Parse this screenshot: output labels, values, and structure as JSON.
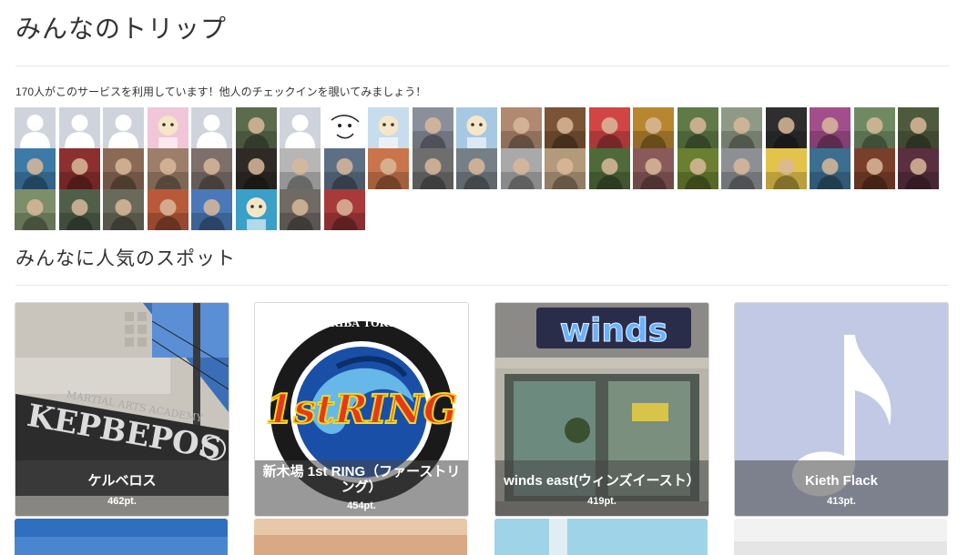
{
  "page": {
    "title": "みんなのトリップ",
    "intro": "170人がこのサービスを利用しています！他人のチェックインを覗いてみましょう！",
    "popular_heading": "みんなに人気のスポット"
  },
  "avatars": [
    {
      "kind": "default"
    },
    {
      "kind": "default"
    },
    {
      "kind": "default"
    },
    {
      "kind": "cartoon",
      "color": "#f0c6d8"
    },
    {
      "kind": "default"
    },
    {
      "kind": "photo",
      "color": "#5b6b4d"
    },
    {
      "kind": "default"
    },
    {
      "kind": "smiley"
    },
    {
      "kind": "cartoon",
      "color": "#c7dcec"
    },
    {
      "kind": "photo",
      "color": "#8a8f9c"
    },
    {
      "kind": "cartoon",
      "color": "#a7c8e2"
    },
    {
      "kind": "photo",
      "color": "#b08970"
    },
    {
      "kind": "photo",
      "color": "#7a5434"
    },
    {
      "kind": "photo",
      "color": "#d14545"
    },
    {
      "kind": "photo",
      "color": "#b8862f"
    },
    {
      "kind": "photo",
      "color": "#5f7a46"
    },
    {
      "kind": "photo",
      "color": "#8f9a86"
    },
    {
      "kind": "photo",
      "color": "#2e2e2e"
    },
    {
      "kind": "photo",
      "color": "#a14f8c"
    },
    {
      "kind": "photo",
      "color": "#6f8a63"
    },
    {
      "kind": "photo",
      "color": "#4f5a3d"
    },
    {
      "kind": "photo",
      "color": "#3d7aa8"
    },
    {
      "kind": "photo",
      "color": "#8c2f2f"
    },
    {
      "kind": "photo",
      "color": "#8a6a55"
    },
    {
      "kind": "photo",
      "color": "#9c7e6a"
    },
    {
      "kind": "photo",
      "color": "#7d6f6a"
    },
    {
      "kind": "photo",
      "color": "#2f2a26"
    },
    {
      "kind": "photo",
      "color": "#b6b6b6"
    },
    {
      "kind": "photo",
      "color": "#5d6f84"
    },
    {
      "kind": "photo",
      "color": "#c9744a"
    },
    {
      "kind": "photo",
      "color": "#6e6e6e"
    },
    {
      "kind": "photo",
      "color": "#777f86"
    },
    {
      "kind": "photo",
      "color": "#a9a9a9"
    },
    {
      "kind": "photo",
      "color": "#b39a7a"
    },
    {
      "kind": "photo",
      "color": "#4f6a3a"
    },
    {
      "kind": "photo",
      "color": "#8a5a5a"
    },
    {
      "kind": "photo",
      "color": "#6a7f2f"
    },
    {
      "kind": "photo",
      "color": "#8c9094"
    },
    {
      "kind": "photo",
      "color": "#e3c34a"
    },
    {
      "kind": "photo",
      "color": "#3b6e8f"
    },
    {
      "kind": "photo",
      "color": "#7a3f2a"
    },
    {
      "kind": "photo",
      "color": "#5a2f3f"
    },
    {
      "kind": "photo",
      "color": "#7d8f6a"
    },
    {
      "kind": "photo",
      "color": "#4f5f4a"
    },
    {
      "kind": "photo",
      "color": "#6a6a5a"
    },
    {
      "kind": "photo",
      "color": "#b85a3a"
    },
    {
      "kind": "photo",
      "color": "#4a78b8"
    },
    {
      "kind": "cartoon",
      "color": "#3aa0c8"
    },
    {
      "kind": "photo",
      "color": "#6f6a63"
    },
    {
      "kind": "photo",
      "color": "#a83a3a"
    }
  ],
  "spots": [
    {
      "name": "ケルベロス",
      "points": "462pt.",
      "photo": "kerberos"
    },
    {
      "name": "新木場 1st RING（ファーストリング）",
      "points": "454pt.",
      "photo": "ring"
    },
    {
      "name": "winds east(ウィンズイースト）",
      "points": "419pt.",
      "photo": "winds"
    },
    {
      "name": "Kieth Flack",
      "points": "413pt.",
      "photo": "music"
    }
  ],
  "spot_images": {
    "ring_logo_text": "1stRING",
    "ring_circle_text": "TOKYO SHINKIBA TOKYO SHINKIBA",
    "winds_sign": "winds",
    "kerberos_sign": "KEPBEPOS",
    "kerberos_top": "MARTIAL ARTS ACADEMY"
  },
  "colors": {
    "music_bg": "#c1c9e4",
    "overlay": "rgba(70,70,70,0.55)"
  }
}
